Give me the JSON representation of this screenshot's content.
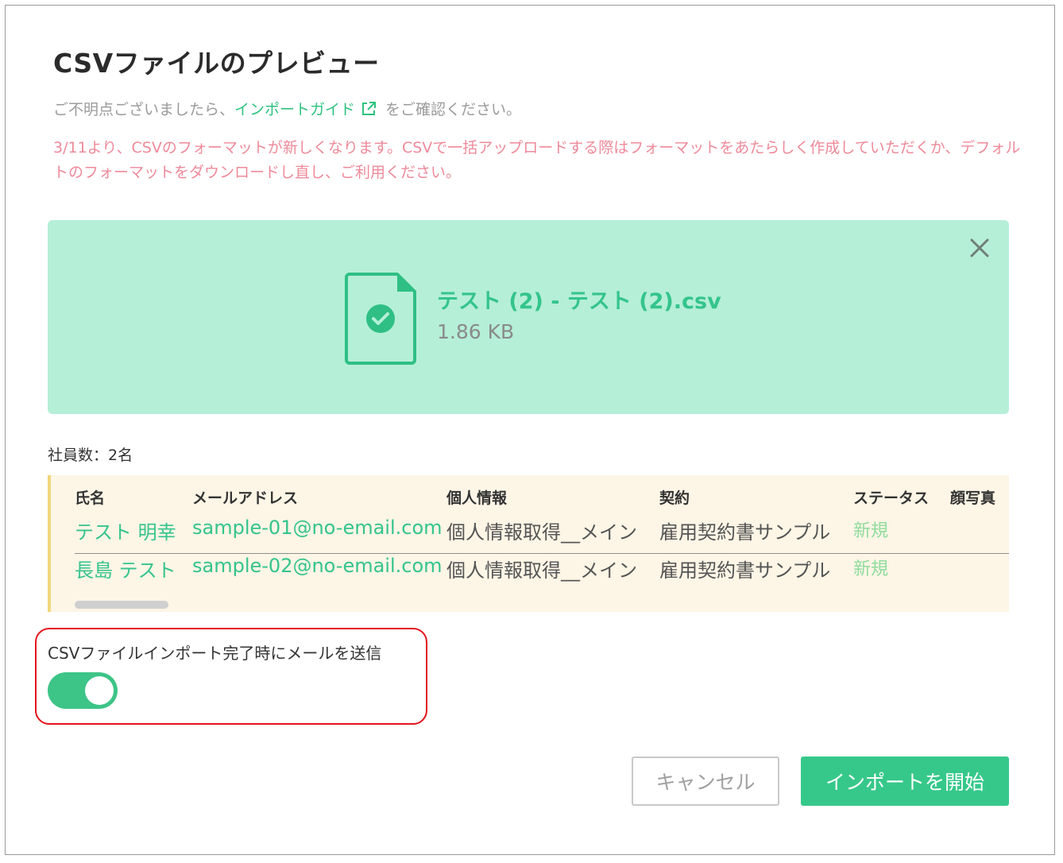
{
  "dialog": {
    "title": "CSVファイルのプレビュー",
    "help_prefix": "ご不明点ございましたら、",
    "help_link": "インポートガイド",
    "help_suffix": "をご確認ください。",
    "notice": "3/11より、CSVのフォーマットが新しくなります。CSVで一括アップロードする際はフォーマットをあたらしく作成していただくか、デフォルトのフォーマットをダウンロードし直し、ご利用ください。"
  },
  "file": {
    "name": "テスト (2) - テスト (2).csv",
    "size": "1.86 KB"
  },
  "employee_count": "社員数：2名",
  "table": {
    "headers": [
      "氏名",
      "メールアドレス",
      "個人情報",
      "契約",
      "ステータス",
      "顔写真"
    ],
    "rows": [
      [
        "テスト 明幸",
        "sample-01@no-email.com",
        "個人情報取得__メイン",
        "雇用契約書サンプル",
        "新規"
      ],
      [
        "長島 テスト",
        "sample-02@no-email.com",
        "個人情報取得__メイン",
        "雇用契約書サンプル",
        "新規"
      ]
    ]
  },
  "email_toggle": {
    "label": "CSVファイルインポート完了時にメールを送信",
    "enabled": true
  },
  "buttons": {
    "cancel": "キャンセル",
    "import": "インポートを開始"
  },
  "colors": {
    "accent": "#36c88a",
    "dropzone": "#b5efd7",
    "notice": "#ee8a9a",
    "highlight": "#e3151b"
  }
}
